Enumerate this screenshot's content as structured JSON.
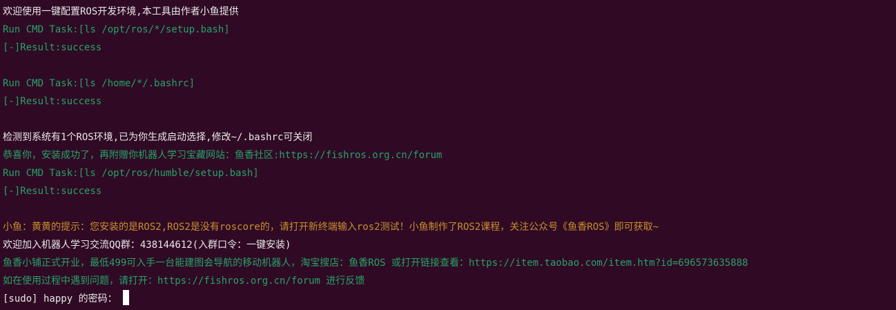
{
  "terminal": {
    "colors": {
      "background": "#300a24",
      "white": "#e8e8e8",
      "green": "#26a269",
      "orange": "#c7902e",
      "cursor": "#ffffff"
    },
    "lines": [
      {
        "text": "欢迎使用一键配置ROS开发环境,本工具由作者小鱼提供",
        "color": "white"
      },
      {
        "text": "Run CMD Task:[ls /opt/ros/*/setup.bash]",
        "color": "green"
      },
      {
        "text": "[-]Result:success",
        "color": "green"
      },
      {
        "text": "",
        "color": "white"
      },
      {
        "text": "Run CMD Task:[ls /home/*/.bashrc]",
        "color": "green"
      },
      {
        "text": "[-]Result:success",
        "color": "green"
      },
      {
        "text": "",
        "color": "white"
      },
      {
        "text": "检测到系统有1个ROS环境,已为你生成启动选择,修改~/.bashrc可关闭",
        "color": "white"
      },
      {
        "text": "恭喜你，安装成功了，再附赠你机器人学习宝藏网站：鱼香社区:https://fishros.org.cn/forum",
        "color": "green"
      },
      {
        "text": "Run CMD Task:[ls /opt/ros/humble/setup.bash]",
        "color": "green"
      },
      {
        "text": "[-]Result:success",
        "color": "green"
      },
      {
        "text": "",
        "color": "white"
      },
      {
        "text": "小鱼：黄黄的提示：您安装的是ROS2,ROS2是没有roscore的，请打开新终端输入ros2测试！小鱼制作了ROS2课程，关注公众号《鱼香ROS》即可获取~",
        "color": "orange"
      },
      {
        "text": "欢迎加入机器人学习交流QQ群：438144612(入群口令：一键安装)",
        "color": "white"
      },
      {
        "text": "鱼香小铺正式开业，最低499可入手一台能建图会导航的移动机器人，淘宝搜店：鱼香ROS 或打开链接查看：https://item.taobao.com/item.htm?id=696573635888",
        "color": "green"
      },
      {
        "text": "如在使用过程中遇到问题，请打开：https://fishros.org.cn/forum 进行反馈",
        "color": "green"
      }
    ],
    "prompt": {
      "text": "[sudo] happy 的密码：",
      "color": "white"
    }
  }
}
